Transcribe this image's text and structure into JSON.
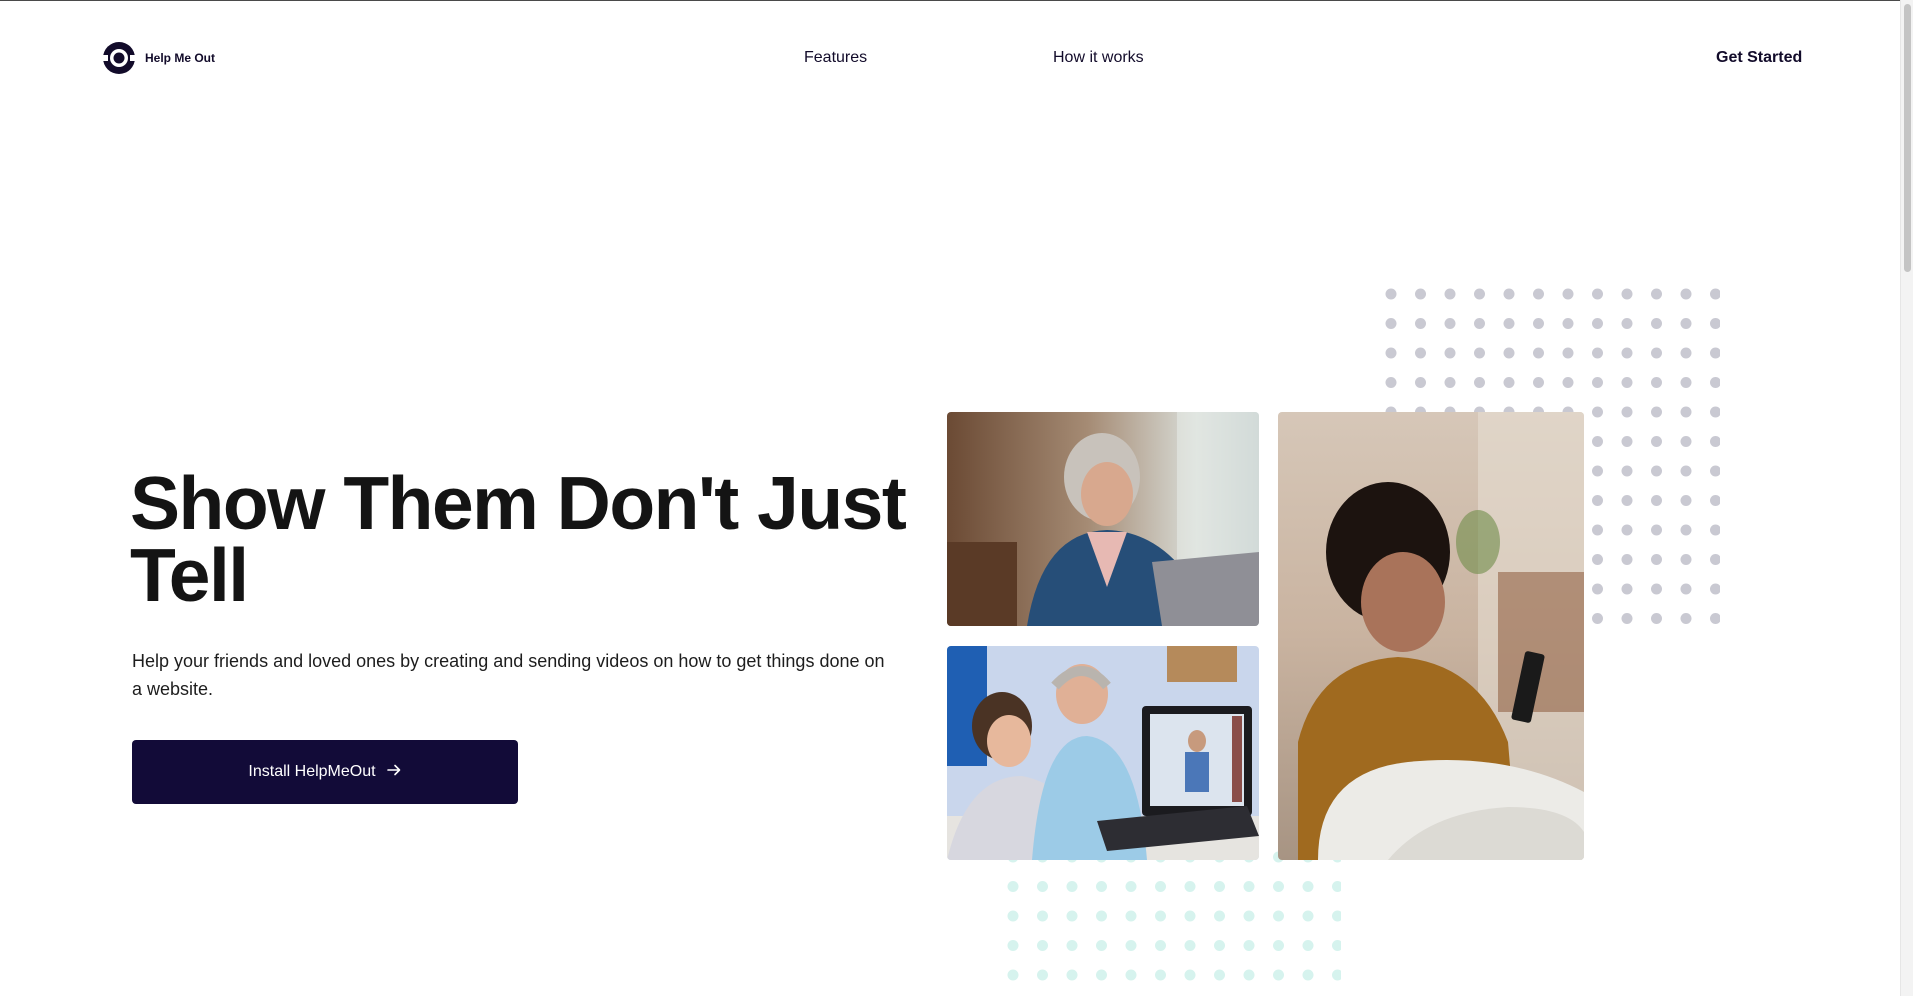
{
  "brand": {
    "name": "Help Me Out",
    "logo_icon": "helpmeout-logo-icon"
  },
  "nav": {
    "features": "Features",
    "how_it_works": "How it works",
    "get_started": "Get Started"
  },
  "hero": {
    "headline": "Show Them Don't Just Tell",
    "subtext": "Help your friends and loved ones by creating and sending videos on how to get things done on a website.",
    "cta_label": "Install HelpMeOut",
    "cta_icon": "arrow-right-icon"
  },
  "colors": {
    "primary": "#120b38",
    "text": "#141414",
    "dots_gray": "#c9c9d2",
    "dots_mint": "#d6f3ee"
  }
}
